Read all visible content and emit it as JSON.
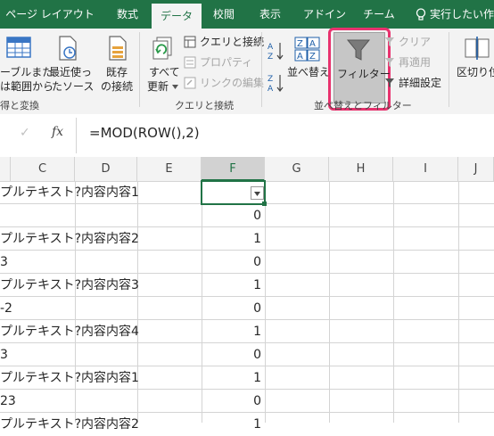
{
  "tabs": [
    {
      "label": "ページ レイアウト"
    },
    {
      "label": "数式"
    },
    {
      "label": "データ"
    },
    {
      "label": "校閲"
    },
    {
      "label": "表示"
    },
    {
      "label": "アドイン"
    },
    {
      "label": "チーム"
    },
    {
      "label": "実行したい作"
    }
  ],
  "ribbon": {
    "table_range_l1": "ーブルまた",
    "table_range_l2": "は範囲から",
    "recent_l1": "最近使っ",
    "recent_l2": "たソース",
    "existing_l1": "既存",
    "existing_l2": "の接続",
    "refresh_l1": "すべて",
    "refresh_l2": "更新",
    "queries": "クエリと接続",
    "properties": "プロパティ",
    "edit_links": "リンクの編集",
    "sort": "並べ替え",
    "filter": "フィルター",
    "clear": "クリア",
    "reapply": "再適用",
    "advanced": "詳細設定",
    "text_to_cols": "区切り位",
    "group_get": "得と変換",
    "group_queries": "クエリと接続",
    "group_sort": "並べ替えとフィルター"
  },
  "formula_bar": {
    "cancel": "✓",
    "fx": "fx",
    "formula": "=MOD(ROW(),2)"
  },
  "columns": [
    "C",
    "D",
    "E",
    "F",
    "G",
    "H",
    "I",
    "J"
  ],
  "rows": [
    {
      "c": "プルテキスト?内容内容1",
      "f": ""
    },
    {
      "c": "",
      "f": "0"
    },
    {
      "c": "プルテキスト?内容内容2",
      "f": "1"
    },
    {
      "c": "3",
      "f": "0"
    },
    {
      "c": "プルテキスト?内容内容3",
      "f": "1"
    },
    {
      "c": "-2",
      "f": "0"
    },
    {
      "c": "プルテキスト?内容内容4",
      "f": "1"
    },
    {
      "c": "3",
      "f": "0"
    },
    {
      "c": "プルテキスト?内容内容1",
      "f": "1"
    },
    {
      "c": "23",
      "f": "0"
    },
    {
      "c": "プルテキスト?内容内容2",
      "f": "1"
    }
  ],
  "colors": {
    "excel_green": "#217346",
    "highlight": "#e8326e"
  }
}
